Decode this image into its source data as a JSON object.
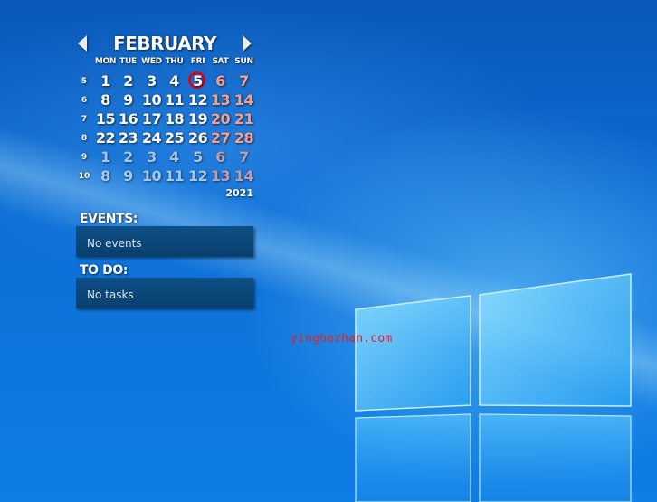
{
  "calendar": {
    "month": "FEBRUARY",
    "year": "2021",
    "weekdays": [
      "MON",
      "TUE",
      "WED",
      "THU",
      "FRI",
      "SAT",
      "SUN"
    ],
    "weeks": [
      {
        "num": "5",
        "days": [
          "1",
          "2",
          "3",
          "4",
          "5",
          "6",
          "7"
        ]
      },
      {
        "num": "6",
        "days": [
          "8",
          "9",
          "10",
          "11",
          "12",
          "13",
          "14"
        ]
      },
      {
        "num": "7",
        "days": [
          "15",
          "16",
          "17",
          "18",
          "19",
          "20",
          "21"
        ]
      },
      {
        "num": "8",
        "days": [
          "22",
          "23",
          "24",
          "25",
          "26",
          "27",
          "28"
        ]
      },
      {
        "num": "9",
        "days": [
          "1",
          "2",
          "3",
          "4",
          "5",
          "6",
          "7"
        ]
      },
      {
        "num": "10",
        "days": [
          "8",
          "9",
          "10",
          "11",
          "12",
          "13",
          "14"
        ]
      }
    ],
    "today": "5"
  },
  "events": {
    "title": "EVENTS:",
    "text": "No events"
  },
  "todo": {
    "title": "TO DO:",
    "text": "No tasks"
  },
  "watermark": "yinghezhan.com",
  "colors": {
    "weekend": "#f4a092",
    "today_ring": "#d0091c",
    "panel": "#0d4f86"
  }
}
